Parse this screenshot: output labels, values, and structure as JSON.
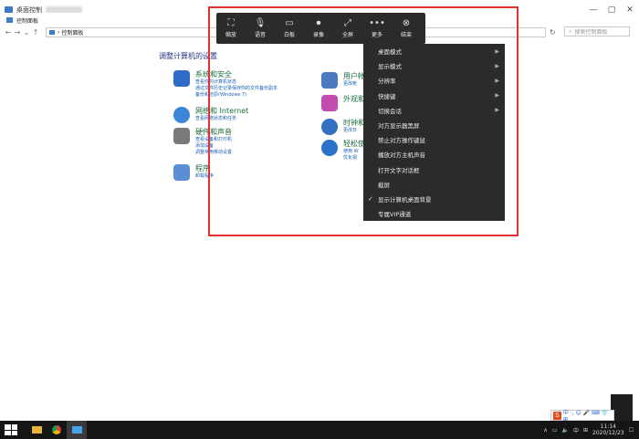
{
  "window": {
    "title": "桌面控制",
    "controls": [
      "—",
      "▢",
      "✕"
    ]
  },
  "explorer": {
    "title": "控制面板",
    "breadcrumb": "控制面板",
    "search_placeholder": "搜索控制面板",
    "nav": [
      "←",
      "→",
      "⌄",
      "↑"
    ]
  },
  "panel": {
    "heading": "调整计算机的设置",
    "categories": [
      {
        "title": "系统和安全",
        "subs": [
          "查看你的计算机状态",
          "通过文件历史记录保存你的文件备份副本",
          "备份和还原(Windows 7)"
        ],
        "color": "#2f6bc9"
      },
      {
        "title": "网络和 Internet",
        "subs": [
          "查看网络状态和任务"
        ],
        "color": "#3b86d6"
      },
      {
        "title": "硬件和声音",
        "subs": [
          "查看设备和打印机",
          "添加设备",
          "调整常用移动设置"
        ],
        "color": "#7a7a7a"
      },
      {
        "title": "程序",
        "subs": [
          "卸载程序"
        ],
        "color": "#5a8fd6"
      },
      {
        "title": "用户帐",
        "subs": [
          "更改帐"
        ],
        "color": "#4a7ac0"
      },
      {
        "title": "外观和",
        "subs": [],
        "color": "#c24db0"
      },
      {
        "title": "时钟和",
        "subs": [
          "更改日"
        ],
        "color": "#3470c2"
      },
      {
        "title": "轻松使",
        "subs": [
          "使用 W",
          "优化视"
        ],
        "color": "#2b72c8"
      }
    ]
  },
  "toolbar": {
    "buttons": [
      {
        "label": "缩放",
        "glyph": "⛶"
      },
      {
        "label": "语音",
        "glyph": "🎙"
      },
      {
        "label": "白板",
        "glyph": "▭"
      },
      {
        "label": "录像",
        "glyph": "⏺"
      },
      {
        "label": "全屏",
        "glyph": "⤢"
      },
      {
        "label": "更多",
        "glyph": "•••"
      },
      {
        "label": "结束",
        "glyph": "⊗"
      }
    ]
  },
  "menu": {
    "items": [
      {
        "label": "桌面模式",
        "submenu": true
      },
      {
        "label": "显示模式",
        "submenu": true
      },
      {
        "label": "分辨率",
        "submenu": true
      },
      {
        "label": "快捷键",
        "submenu": true
      },
      {
        "label": "切换会话",
        "submenu": true
      },
      {
        "label": "对方显示器黑屏",
        "submenu": false
      },
      {
        "label": "禁止对方操作键鼠",
        "submenu": false
      },
      {
        "label": "播放对方主机声音",
        "submenu": false
      },
      {
        "label": "打开文字对话框",
        "submenu": false
      },
      {
        "label": "截屏",
        "submenu": false
      },
      {
        "label": "显示计算机桌面背景",
        "submenu": false,
        "checked": true
      },
      {
        "label": "专属VIP通道",
        "submenu": false
      }
    ]
  },
  "ime": {
    "logo": "S",
    "text": "中 ·, ☺ 🎤 ⌨ 👕 ⊞"
  },
  "taskbar": {
    "time": "11:14",
    "date": "2020/12/23",
    "ime_lang": "中"
  }
}
